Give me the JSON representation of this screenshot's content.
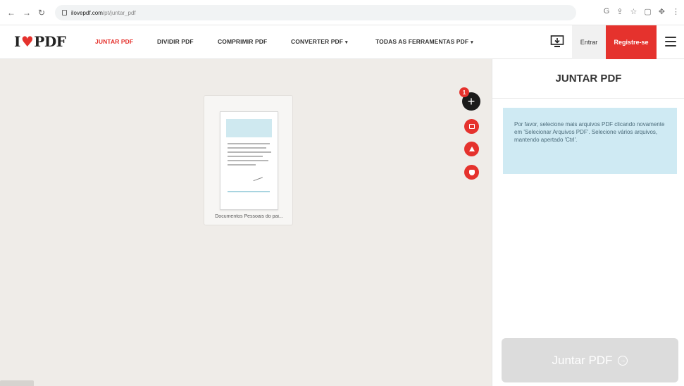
{
  "browser": {
    "back_icon": "back-arrow-icon",
    "forward_icon": "forward-arrow-icon",
    "reload_icon": "reload-icon",
    "url_domain": "ilovepdf.com",
    "url_path": "/pt/juntar_pdf",
    "action_icons": [
      "google-lens-icon",
      "share-icon",
      "star-icon",
      "sidebar-icon",
      "extensions-icon",
      "menu-kebab-icon"
    ]
  },
  "header": {
    "logo_i": "I",
    "logo_pdf": "PDF",
    "nav": [
      {
        "label": "JUNTAR PDF",
        "active": true
      },
      {
        "label": "DIVIDIR PDF"
      },
      {
        "label": "COMPRIMIR PDF"
      },
      {
        "label": "CONVERTER PDF",
        "has_caret": true
      },
      {
        "label": "TODAS AS FERRAMENTAS PDF",
        "has_caret": true
      }
    ],
    "caret": "▾",
    "entrar": "Entrar",
    "registre": "Registre-se"
  },
  "workspace": {
    "file_name": "Documentos Pessoais do pai...",
    "add_badge": "1",
    "add_symbol": "+"
  },
  "sidebar": {
    "title": "JUNTAR PDF",
    "info": "Por favor, selecione mais arquivos PDF clicando novamente em 'Selecionar Arquivos PDF'. Selecione vários arquivos, mantendo apertado 'Ctrl'.",
    "merge_label": "Juntar PDF",
    "merge_icon": "→"
  },
  "colors": {
    "brand_red": "#e5322d",
    "info_bg": "#cfeaf3",
    "workspace_bg": "#efece8"
  }
}
